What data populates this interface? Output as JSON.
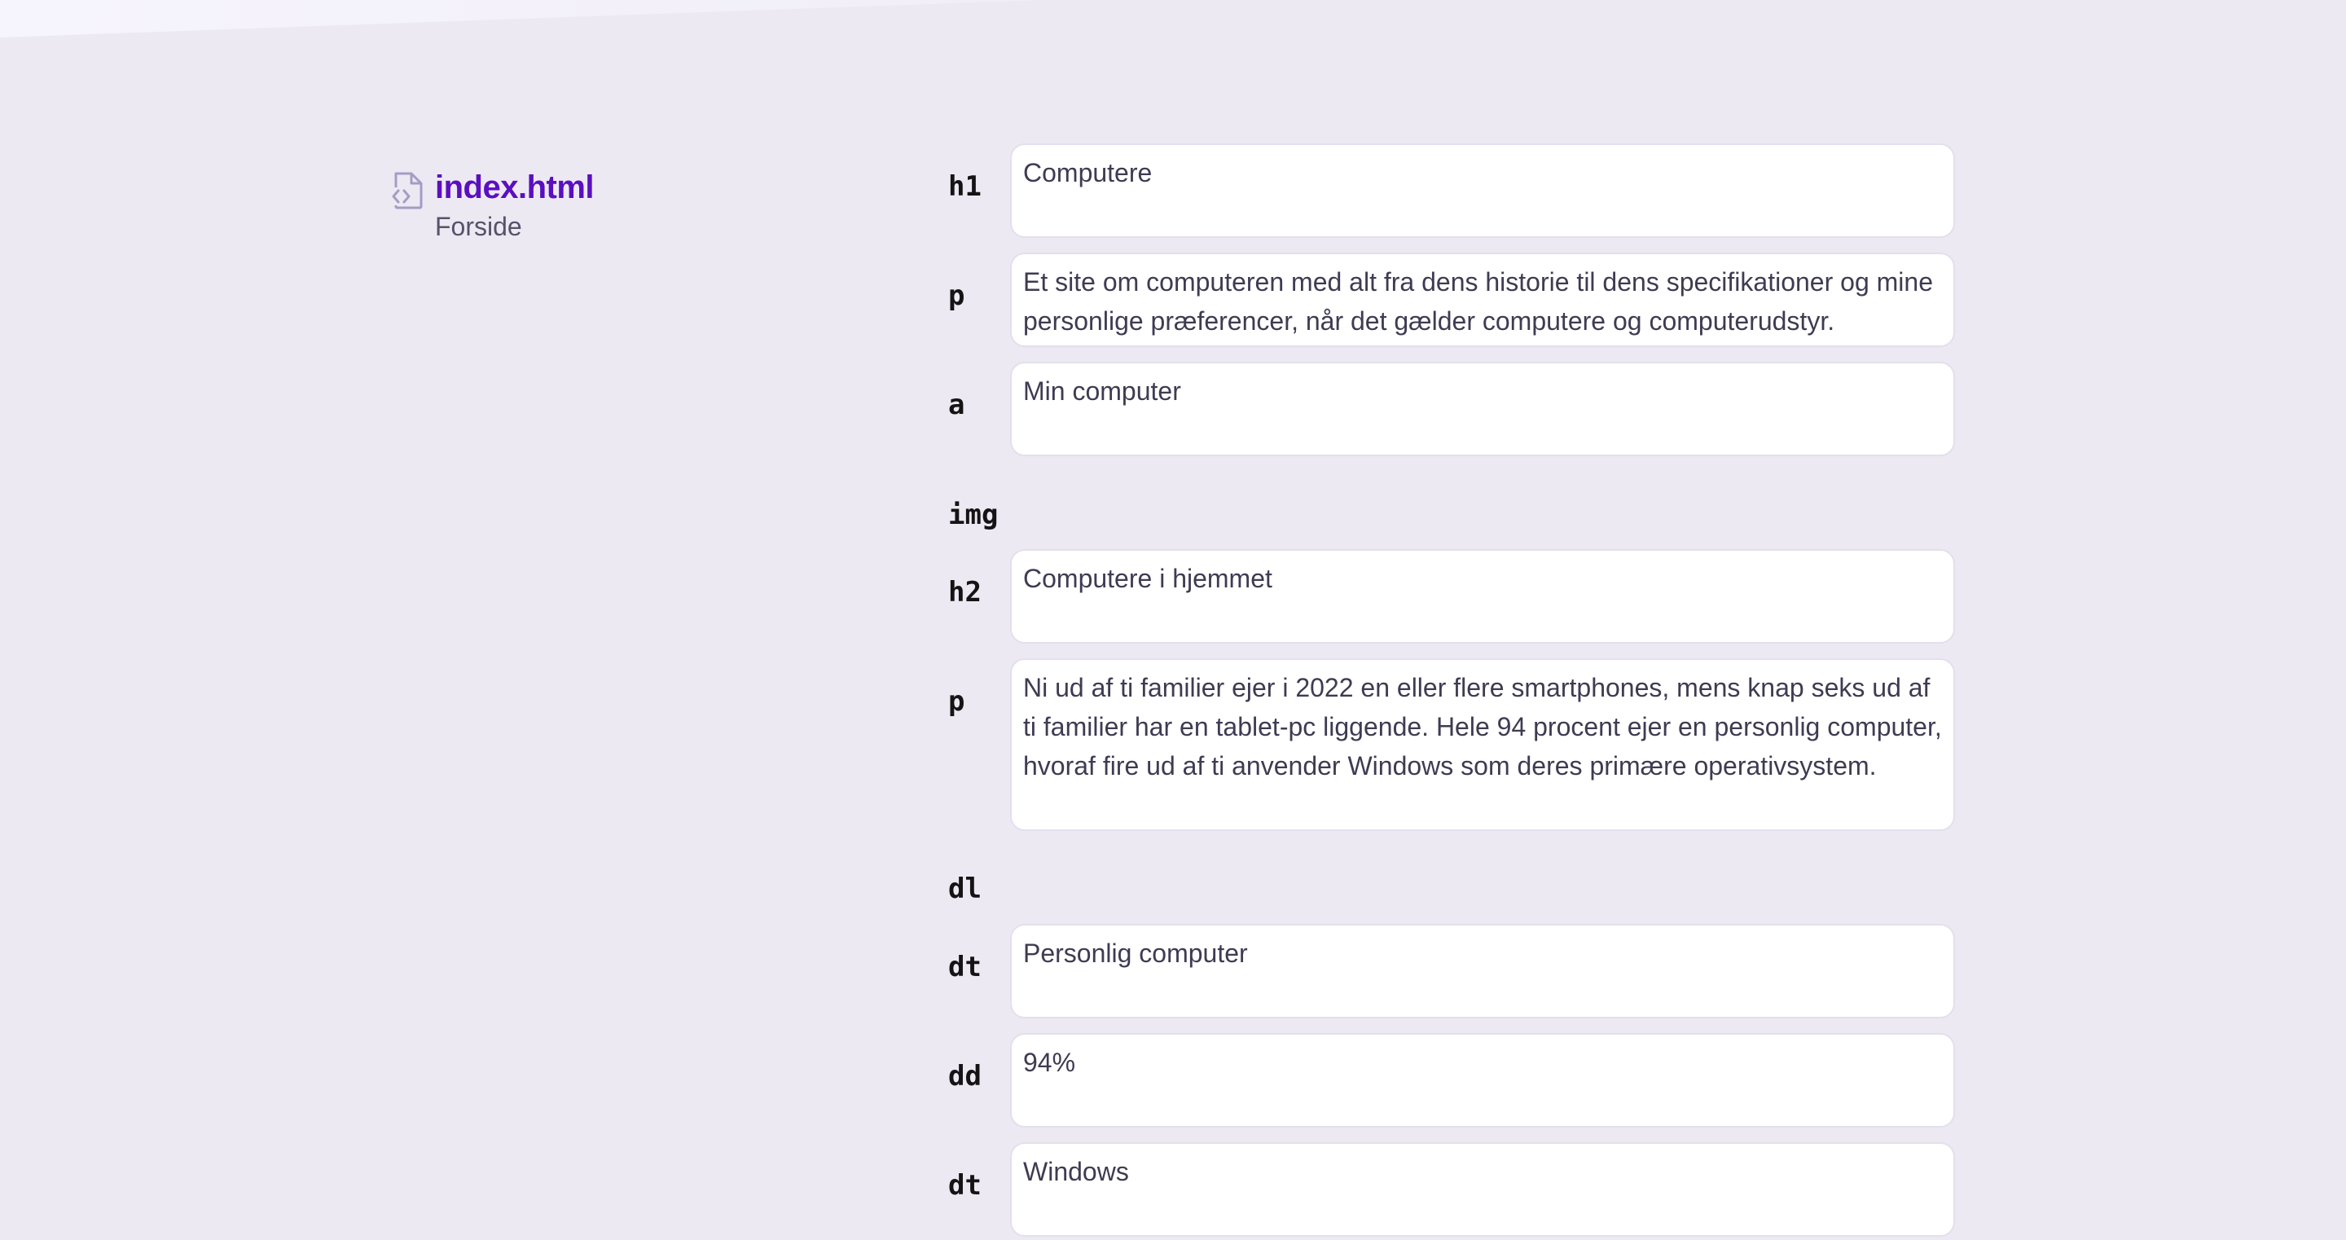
{
  "file": {
    "icon": "file-code-icon",
    "name": "index.html",
    "subtitle": "Forside"
  },
  "elements": [
    {
      "tag": "h1",
      "value": "Computere"
    },
    {
      "tag": "p",
      "value": "Et site om computeren med alt fra dens historie til dens specifikationer og mine personlige præferencer, når det gælder computere og computerudstyr."
    },
    {
      "tag": "a",
      "value": "Min computer"
    },
    {
      "tag": "img"
    },
    {
      "tag": "h2",
      "value": "Computere i hjemmet"
    },
    {
      "tag": "p",
      "value": "Ni ud af ti familier ejer i 2022 en eller flere smartphones, mens knap seks ud af ti familier har en tablet-pc liggende. Hele 94 procent ejer en personlig computer, hvoraf fire ud af ti anvender Windows som deres primære operativsystem."
    },
    {
      "tag": "dl"
    },
    {
      "tag": "dt",
      "value": "Personlig computer"
    },
    {
      "tag": "dd",
      "value": "94%"
    },
    {
      "tag": "dt",
      "value": "Windows"
    }
  ],
  "colors": {
    "background": "#ede9f3",
    "file_name": "#5b0fc0",
    "field_background": "#ffffff",
    "field_border": "#e3dfec",
    "tag_text": "#141414"
  }
}
